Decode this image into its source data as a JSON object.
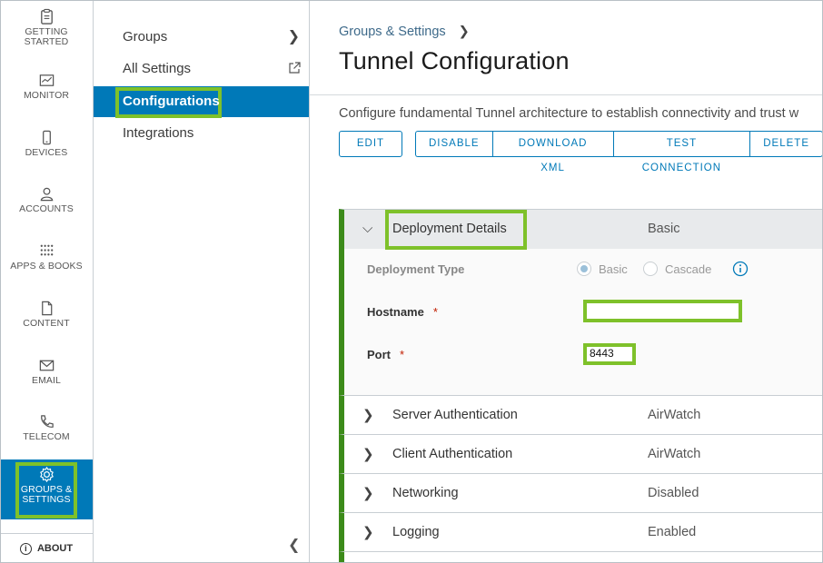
{
  "leftnav": {
    "items": [
      {
        "label": "GETTING\nSTARTED",
        "line1": "GETTING",
        "line2": "STARTED",
        "icon": "clipboard-icon"
      },
      {
        "label": "MONITOR",
        "icon": "monitor-chart-icon"
      },
      {
        "label": "DEVICES",
        "icon": "phone-icon"
      },
      {
        "label": "ACCOUNTS",
        "icon": "user-icon"
      },
      {
        "label": "APPS & BOOKS",
        "icon": "apps-grid-icon"
      },
      {
        "label": "CONTENT",
        "icon": "document-icon"
      },
      {
        "label": "EMAIL",
        "icon": "envelope-icon"
      },
      {
        "label": "TELECOM",
        "icon": "telephone-icon"
      }
    ],
    "active": {
      "line1": "GROUPS &",
      "line2": "SETTINGS",
      "icon": "gear-icon"
    },
    "about": "ABOUT"
  },
  "subnav": {
    "items": [
      {
        "label": "Groups"
      },
      {
        "label": "All Settings"
      },
      {
        "label": "Configurations"
      },
      {
        "label": "Integrations"
      }
    ]
  },
  "main": {
    "breadcrumb": "Groups & Settings",
    "title": "Tunnel Configuration",
    "description": "Configure fundamental Tunnel architecture to establish connectivity and trust w",
    "buttons": {
      "edit": "EDIT",
      "disable": "DISABLE",
      "download_xml": "DOWNLOAD XML",
      "test_connection": "TEST CONNECTION",
      "delete": "DELETE"
    },
    "deployment": {
      "title": "Deployment Details",
      "value": "Basic",
      "type_label": "Deployment Type",
      "radio_basic": "Basic",
      "radio_cascade": "Cascade",
      "hostname_label": "Hostname",
      "port_label": "Port",
      "required_mark": "*",
      "hostname_value": "",
      "port_value": "8443"
    },
    "sections": [
      {
        "title": "Server Authentication",
        "value": "AirWatch"
      },
      {
        "title": "Client Authentication",
        "value": "AirWatch"
      },
      {
        "title": "Networking",
        "value": "Disabled"
      },
      {
        "title": "Logging",
        "value": "Enabled"
      }
    ]
  },
  "colors": {
    "accent": "#0079b8",
    "highlight": "#7ec12a",
    "panel_bar": "#3c8b1a"
  }
}
